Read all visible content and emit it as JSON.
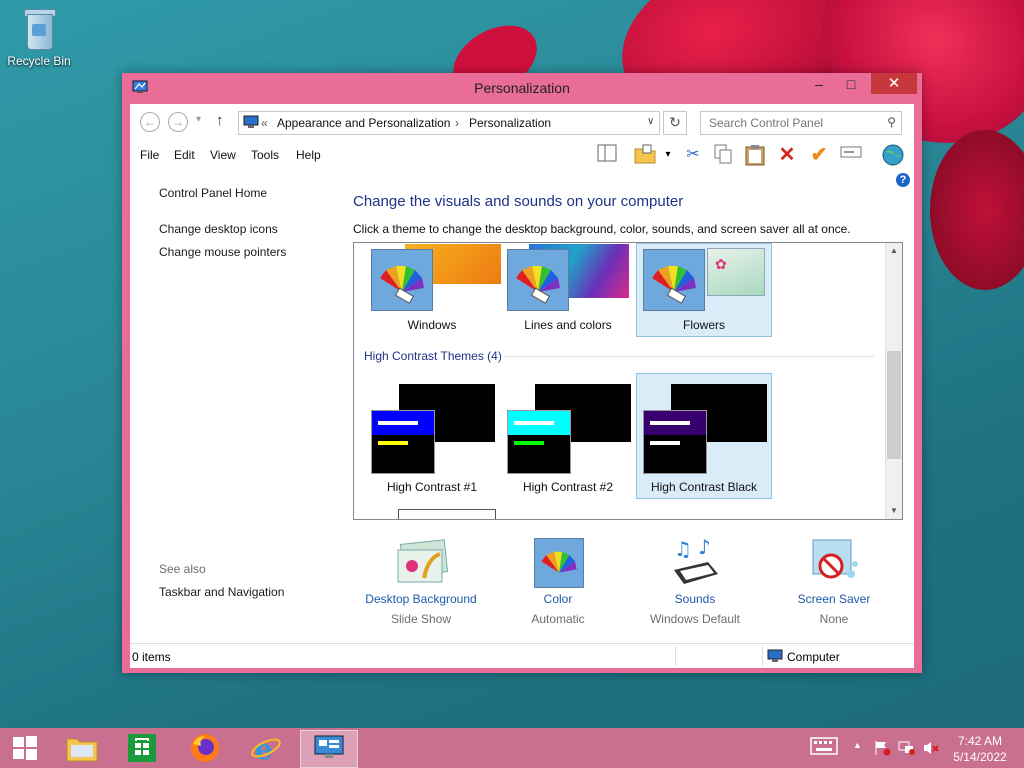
{
  "desktop": {
    "recycle_bin_label": "Recycle Bin"
  },
  "window": {
    "title": "Personalization",
    "minimize": "–",
    "maximize": "□",
    "close": "✕"
  },
  "nav": {
    "back": "←",
    "forward": "→",
    "dropdown": "▾",
    "up": "↑",
    "breadcrumb_prefix": "«",
    "breadcrumb": [
      "Appearance and Personalization",
      "Personalization"
    ],
    "separator": "›",
    "address_dropdown": "∨",
    "refresh": "↻",
    "search_placeholder": "Search Control Panel"
  },
  "menu": [
    "File",
    "Edit",
    "View",
    "Tools",
    "Help"
  ],
  "sidebar": {
    "home": "Control Panel Home",
    "links": [
      "Change desktop icons",
      "Change mouse pointers"
    ],
    "see_also_label": "See also",
    "see_also_links": [
      "Taskbar and Navigation"
    ]
  },
  "main": {
    "heading": "Change the visuals and sounds on your computer",
    "subheading": "Click a theme to change the desktop background, color, sounds, and screen saver all at once.",
    "themes": [
      {
        "label": "Windows"
      },
      {
        "label": "Lines and colors"
      },
      {
        "label": "Flowers",
        "selected": true
      }
    ],
    "high_contrast_group": "High Contrast Themes (4)",
    "high_contrast_themes": [
      {
        "label": "High Contrast #1",
        "bar": "#0000ff",
        "line1": "#ffffff",
        "line2": "#ffff00"
      },
      {
        "label": "High Contrast #2",
        "bar": "#00ffff",
        "line1": "#ffffff",
        "line2": "#00ff00"
      },
      {
        "label": "High Contrast Black",
        "bar": "#37006e",
        "line1": "#ffffff",
        "line2": "#ffffff",
        "selected": true
      }
    ]
  },
  "bottom_items": [
    {
      "link": "Desktop Background",
      "sub": "Slide Show",
      "icon": "desktop-background-icon"
    },
    {
      "link": "Color",
      "sub": "Automatic",
      "icon": "color-icon"
    },
    {
      "link": "Sounds",
      "sub": "Windows Default",
      "icon": "sounds-icon"
    },
    {
      "link": "Screen Saver",
      "sub": "None",
      "icon": "screen-saver-icon"
    }
  ],
  "status": {
    "items": "0 items",
    "location": "Computer"
  },
  "help": "?",
  "taskbar": {
    "clock_time": "7:42 AM",
    "clock_date": "5/14/2022"
  },
  "colors": {
    "window_frame": "#e96d97",
    "taskbar": "#c96f8f",
    "link": "#1e5aa8",
    "heading": "#1e3287"
  }
}
